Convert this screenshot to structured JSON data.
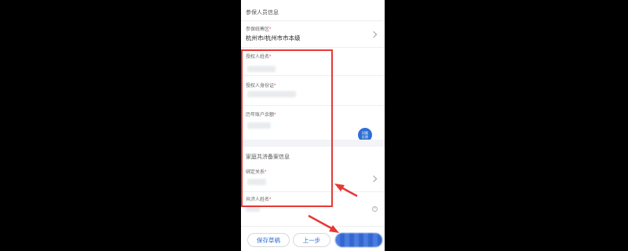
{
  "form": {
    "insured_section_title": "参保人员信息",
    "region_label": "参保统筹区",
    "region_value": "杭州市/杭州市市本级",
    "authorizer_name_label": "授权人姓名",
    "authorizer_id_label": "授权人身份证",
    "account_balance_label": "历年账户余额",
    "family_section_title": "家庭共济备案信息",
    "relation_label": "绑定关系",
    "beneficiary_name_label": "共济人姓名",
    "required_mark": "*"
  },
  "help_fab": {
    "line1": "问题",
    "line2": "反馈"
  },
  "actions": {
    "save_draft": "保存草稿",
    "prev_step": "上一步"
  },
  "colors": {
    "accent": "#2f6fd6",
    "annotation_red": "#e53935"
  }
}
